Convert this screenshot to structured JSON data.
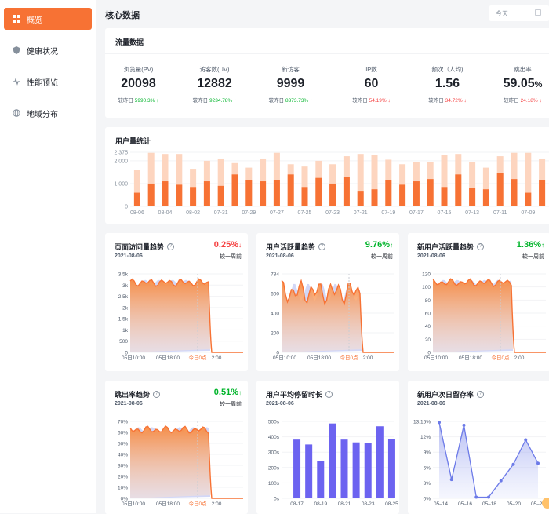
{
  "sidebar": {
    "items": [
      {
        "label": "概览",
        "icon": "dashboard-icon",
        "active": true
      },
      {
        "label": "健康状况",
        "icon": "shield-icon",
        "active": false
      },
      {
        "label": "性能预览",
        "icon": "pulse-icon",
        "active": false
      },
      {
        "label": "地域分布",
        "icon": "globe-icon",
        "active": false
      }
    ]
  },
  "header": {
    "title": "核心数据",
    "date_value": "今天"
  },
  "traffic": {
    "title": "流量数据",
    "compare_prefix": "较昨日",
    "stats": [
      {
        "label": "浏览量(PV)",
        "value": "20098",
        "change": "5990.3%",
        "trend": "up"
      },
      {
        "label": "访客数(UV)",
        "value": "12882",
        "change": "9234.78%",
        "trend": "up"
      },
      {
        "label": "新访客",
        "value": "9999",
        "change": "8373.73%",
        "trend": "up"
      },
      {
        "label": "IP数",
        "value": "60",
        "change": "54.19%",
        "trend": "down"
      },
      {
        "label": "频次（人均)",
        "value": "1.56",
        "change": "34.72%",
        "trend": "down"
      },
      {
        "label": "跳出率",
        "value": "59.05",
        "unit": "%",
        "change": "24.18%",
        "trend": "down"
      }
    ]
  },
  "user_stats": {
    "title": "用户量统计",
    "chart_data": {
      "type": "bar",
      "ylim": [
        0,
        2375
      ],
      "yticks": [
        "2,375",
        "2,000",
        "1,000",
        "0"
      ],
      "xticks": [
        "08-06",
        "08-04",
        "08-02",
        "07-31",
        "07-29",
        "07-27",
        "07-25",
        "07-23",
        "07-21",
        "07-19",
        "07-17",
        "07-15",
        "07-13",
        "07-11",
        "07-09"
      ],
      "series": [
        {
          "values": [
            600,
            1000,
            1100,
            950,
            850,
            1100,
            900,
            1400,
            1150,
            1100,
            1150,
            1400,
            850,
            1250,
            1000,
            1300,
            650,
            750,
            1150,
            950,
            1100,
            1200,
            850,
            1400,
            800,
            750,
            1450,
            1200,
            600,
            1150
          ]
        },
        {
          "values": [
            1600,
            2350,
            2300,
            2300,
            1650,
            2000,
            2100,
            1900,
            1700,
            2100,
            2350,
            1850,
            1750,
            2000,
            1850,
            2200,
            2300,
            2250,
            2050,
            1850,
            1950,
            1950,
            2250,
            2300,
            1950,
            1700,
            2200,
            2350,
            2350,
            2100
          ]
        }
      ]
    }
  },
  "mini_charts": [
    {
      "title": "页面访问量趋势",
      "help": "?",
      "date": "2021-08-06",
      "rate": "0.25%",
      "trend": "down",
      "compare": "较一周前",
      "chart_data": {
        "type": "area",
        "ylim": [
          0,
          3500
        ],
        "yticks": [
          "3.5k",
          "3k",
          "2.5k",
          "2k",
          "1.5k",
          "1k",
          "500",
          "0"
        ],
        "xticks": [
          "05日10:00",
          "05日18:00",
          "今日0点",
          "2:00"
        ]
      }
    },
    {
      "title": "用户活跃量趋势",
      "help": "?",
      "date": "2021-08-06",
      "rate": "9.76%",
      "trend": "up",
      "compare": "较一周前",
      "chart_data": {
        "type": "area",
        "ylim": [
          0,
          784
        ],
        "yticks": [
          "784",
          "600",
          "400",
          "200",
          "0"
        ],
        "xticks": [
          "05日10:00",
          "05日18:00",
          "今日0点",
          "2:00"
        ]
      }
    },
    {
      "title": "新用户活跃量趋势",
      "help": "?",
      "date": "2021-08-06",
      "rate": "1.36%",
      "trend": "up",
      "compare": "较一周前",
      "chart_data": {
        "type": "area",
        "ylim": [
          0,
          120
        ],
        "yticks": [
          "120",
          "100",
          "80",
          "60",
          "40",
          "20",
          "0"
        ],
        "xticks": [
          "05日10:00",
          "05日18:00",
          "今日0点",
          "2:00"
        ]
      }
    },
    {
      "title": "跳出率趋势",
      "help": "?",
      "date": "2021-08-06",
      "rate": "0.51%",
      "trend": "up",
      "compare": "较一周前",
      "chart_data": {
        "type": "area",
        "ylim": [
          0,
          70
        ],
        "yticks": [
          "70%",
          "60%",
          "50%",
          "40%",
          "30%",
          "20%",
          "10%",
          "0%"
        ],
        "xticks": [
          "05日10:00",
          "05日18:00",
          "今日0点",
          "2:00"
        ]
      }
    },
    {
      "title": "用户平均停留时长",
      "help": "?",
      "date": "2021-08-06",
      "chart_data": {
        "type": "bar",
        "ylim": [
          0,
          550
        ],
        "yticks": [
          "500s",
          "400s",
          "300s",
          "200s",
          "100s",
          "0s"
        ],
        "xticks": [
          "08-17",
          "08-19",
          "08-21",
          "08-23",
          "08-25"
        ],
        "values": [
          420,
          385,
          265,
          535,
          420,
          400,
          395,
          515,
          425
        ]
      }
    },
    {
      "title": "新用户次日留存率",
      "help": "?",
      "date": "2021-08-06",
      "chart_data": {
        "type": "area",
        "ylim": [
          0,
          13.16
        ],
        "yticks": [
          "13.16%",
          "12%",
          "9%",
          "6%",
          "3%",
          "0%"
        ],
        "xticks": [
          "05–14",
          "05–16",
          "05–18",
          "05–20",
          "05–22"
        ],
        "values": [
          13,
          3.2,
          12.5,
          0.2,
          0.2,
          3,
          5.8,
          10,
          6
        ]
      }
    }
  ]
}
